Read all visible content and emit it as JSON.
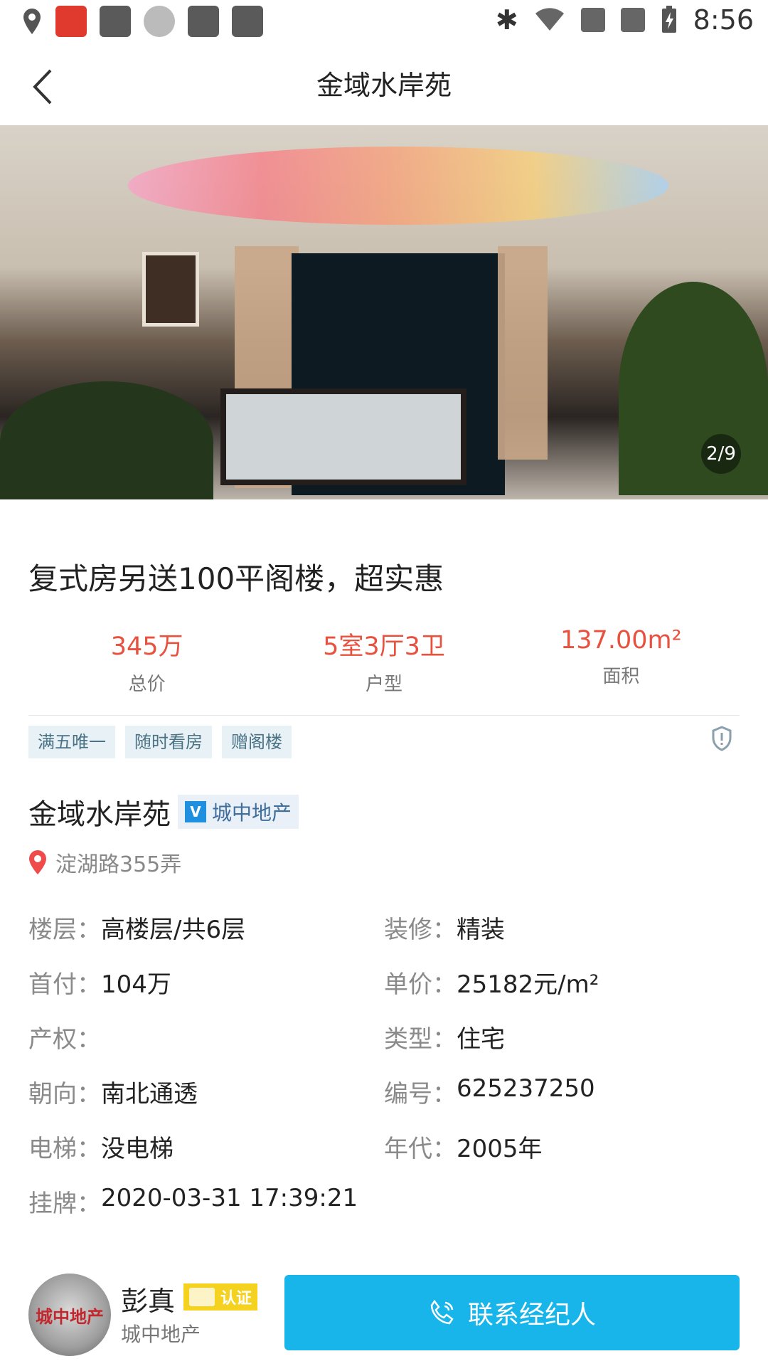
{
  "status_bar": {
    "time": "8:56"
  },
  "header": {
    "title": "金域水岸苑"
  },
  "gallery": {
    "counter": "2/9"
  },
  "listing": {
    "headline": "复式房另送100平阁楼，超实惠",
    "stats": [
      {
        "value": "345万",
        "label": "总价"
      },
      {
        "value": "5室3厅3卫",
        "label": "户型"
      },
      {
        "value": "137.00m²",
        "label": "面积"
      }
    ],
    "tags": [
      "满五唯一",
      "随时看房",
      "赠阁楼"
    ],
    "community": "金域水岸苑",
    "agency_badge": "城中地产",
    "verified_glyph": "V",
    "address": "淀湖路355弄"
  },
  "details": [
    {
      "k1": "楼层：",
      "v1": "高楼层/共6层",
      "k2": "装修：",
      "v2": "精装"
    },
    {
      "k1": "首付：",
      "v1": "104万",
      "k2": "单价：",
      "v2": "25182元/m²"
    },
    {
      "k1": "产权：",
      "v1": "",
      "k2": "类型：",
      "v2": "住宅"
    },
    {
      "k1": "朝向：",
      "v1": "南北通透",
      "k2": "编号：",
      "v2": "625237250"
    },
    {
      "k1": "电梯：",
      "v1": "没电梯",
      "k2": "年代：",
      "v2": "2005年"
    },
    {
      "k1": "挂牌：",
      "v1": "2020-03-31 17:39:21",
      "k2": "",
      "v2": ""
    }
  ],
  "agent": {
    "name": "彭真",
    "badge": "认证",
    "company": "城中地产",
    "avatar_text": "城中地产"
  },
  "contact_button": "联系经纪人",
  "colors": {
    "accent_red": "#e8513e",
    "button_blue": "#17b5e9",
    "tag_bg": "#e8f1f5",
    "badge_yellow": "#f4d21f"
  }
}
